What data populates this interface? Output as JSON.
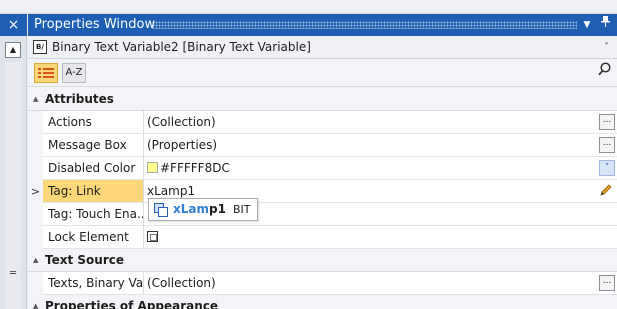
{
  "window": {
    "title": "Properties Window",
    "pin_icon": "pin-icon",
    "menu_icon": "dropdown-arrow-icon"
  },
  "gutter": {
    "close_label": "×",
    "up_label": "▲",
    "grip_label": "═"
  },
  "selector": {
    "object_label": "Binary Text Variable2 [Binary Text Variable]",
    "chevron": "˅"
  },
  "toolbar": {
    "categorized_icon": "categorized-icon",
    "az_label": "A-Z",
    "search_icon": "search-icon"
  },
  "grid": {
    "categories": {
      "attributes": "Attributes",
      "text_source": "Text Source",
      "appearance": "Properties of Appearance"
    },
    "rows": {
      "actions": {
        "name": "Actions",
        "value": "(Collection)"
      },
      "message_box": {
        "name": "Message Box",
        "value": "(Properties)"
      },
      "disabled_color": {
        "name": "Disabled Color",
        "value": "#FFFFF8DC"
      },
      "tag_link": {
        "name": "Tag: Link",
        "value": "xLamp1"
      },
      "tag_touch": {
        "name": "Tag: Touch Ena...",
        "value": ""
      },
      "lock_element": {
        "name": "Lock Element",
        "value": ""
      },
      "texts": {
        "name": "Texts, Binary Va...",
        "value": "(Collection)"
      }
    },
    "ellipsis_label": "...",
    "dropdown_label": "˅",
    "expand_marker": ">",
    "collapse_marker": "▲"
  },
  "autocomplete": {
    "match_prefix": "xLam",
    "match_rest": "p1",
    "type": "BIT"
  },
  "colors": {
    "title_bar": "#1e5fb4",
    "selected_row": "#fbd77a",
    "swatch": "#ffff8d",
    "match_highlight": "#2f7fd1"
  }
}
